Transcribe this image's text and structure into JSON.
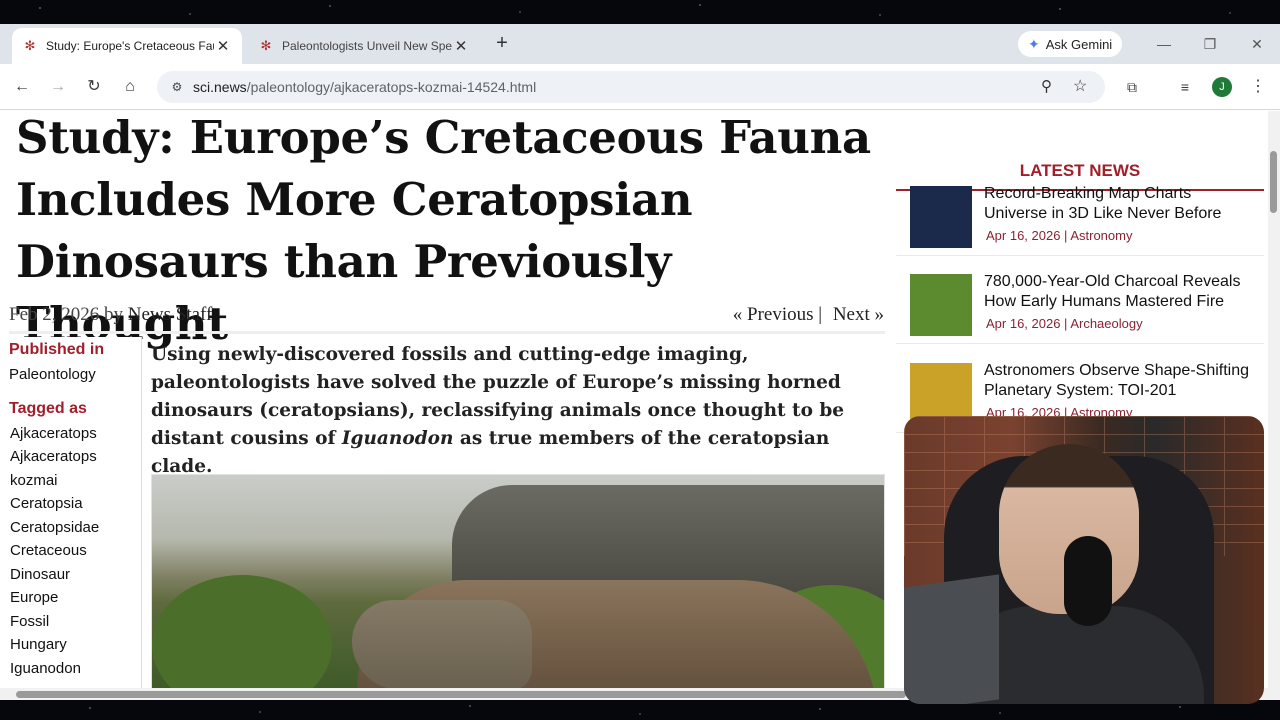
{
  "browser": {
    "tabs": [
      {
        "title": "Study: Europe's Cretaceous Fau",
        "active": true
      },
      {
        "title": "Paleontologists Unveil New Spe",
        "active": false
      }
    ],
    "gemini_label": "Ask Gemini",
    "url_host": "sci.news",
    "url_path": "/paleontology/ajkaceratops-kozmai-14524.html",
    "avatar_initial": "J"
  },
  "article": {
    "title": "Study: Europe’s Cretaceous Fauna Includes More Ceratopsian Dinosaurs than Previously Thought",
    "date": "Feb 2, 2026",
    "by": "by",
    "author": "News Staff",
    "prev": "« Previous |",
    "next": "Next »",
    "lead_before": "Using newly-discovered fossils and cutting-edge imaging, paleontologists have solved the puzzle of Europe’s missing horned dinosaurs (ceratopsians), reclassifying animals once thought to be distant cousins of ",
    "lead_italic": "Iguanodon",
    "lead_after": " as true members of the ceratopsian clade."
  },
  "sidebar_left": {
    "published_label": "Published in",
    "published_value": "Paleontology",
    "tagged_label": "Tagged as",
    "tags": [
      "Ajkaceratops",
      "Ajkaceratops kozmai",
      "Ceratopsia",
      "Ceratopsidae",
      "Cretaceous",
      "Dinosaur",
      "Europe",
      "Fossil",
      "Hungary",
      "Iguanodon"
    ]
  },
  "latest_news": {
    "heading": "LATEST NEWS",
    "items": [
      {
        "title": "Record-Breaking Map Charts Universe in 3D Like Never Before",
        "meta": "Apr 16, 2026 | Astronomy",
        "thumb_color": "#1b2a4a"
      },
      {
        "title": "780,000-Year-Old Charcoal Reveals How Early Humans Mastered Fire",
        "meta": "Apr 16, 2026 | Archaeology",
        "thumb_color": "#5b8a2f"
      },
      {
        "title": "Astronomers Observe Shape-Shifting Planetary System: TOI-201",
        "meta": "Apr 16, 2026 | Astronomy",
        "thumb_color": "#c9a227"
      }
    ]
  },
  "colors": {
    "accent": "#a01f2b",
    "tabbar": "#dfe3ea"
  }
}
